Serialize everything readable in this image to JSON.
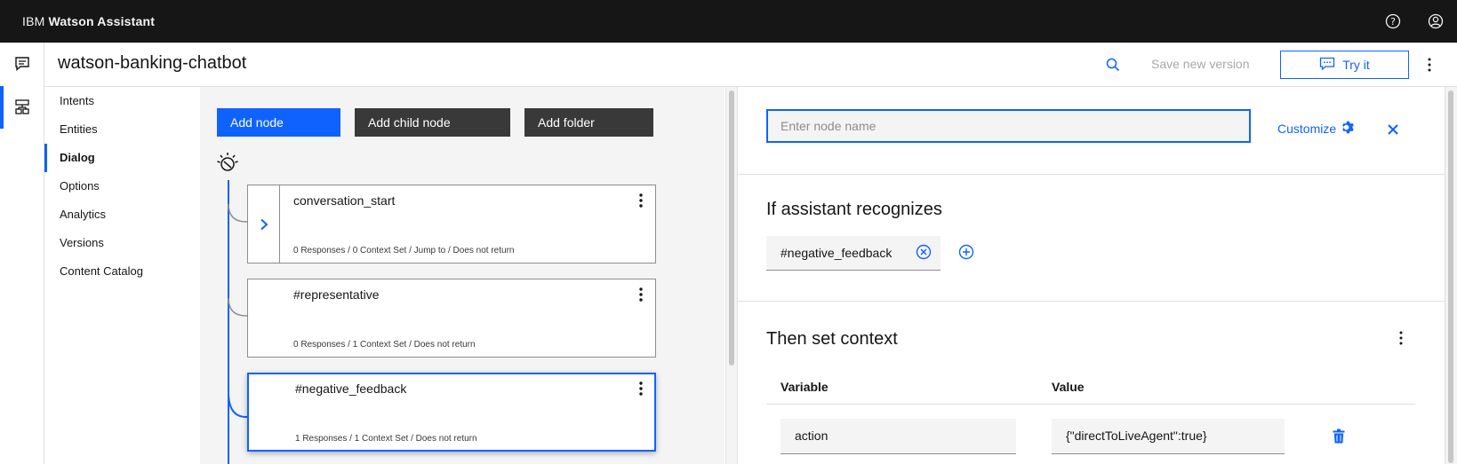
{
  "topbar": {
    "brand_company": "IBM",
    "brand_product": "Watson Assistant"
  },
  "header": {
    "title": "watson-banking-chatbot",
    "save_version": "Save new version",
    "try_it": "Try it"
  },
  "subnav": {
    "items": [
      "Intents",
      "Entities",
      "Dialog",
      "Options",
      "Analytics",
      "Versions",
      "Content Catalog"
    ],
    "active": "Dialog"
  },
  "toolbar": {
    "add_node": "Add node",
    "add_child_node": "Add child node",
    "add_folder": "Add folder"
  },
  "nodes": [
    {
      "name": "conversation_start",
      "meta": "0 Responses / 0 Context Set / Jump to / Does not return"
    },
    {
      "name": "#representative",
      "meta": "0 Responses / 1 Context Set / Does not return"
    },
    {
      "name": "#negative_feedback",
      "meta": "1 Responses / 1 Context Set / Does not return"
    }
  ],
  "panel": {
    "node_name_placeholder": "Enter node name",
    "customize": "Customize",
    "recognizes_title": "If assistant recognizes",
    "condition": "#negative_feedback",
    "context_title": "Then set context",
    "col_variable": "Variable",
    "col_value": "Value",
    "rows": [
      {
        "variable": "action",
        "value": "{\"directToLiveAgent\":true}"
      }
    ]
  },
  "colors": {
    "accent": "#0f62fe",
    "topbar": "#161616",
    "canvas": "#f4f4f4"
  }
}
